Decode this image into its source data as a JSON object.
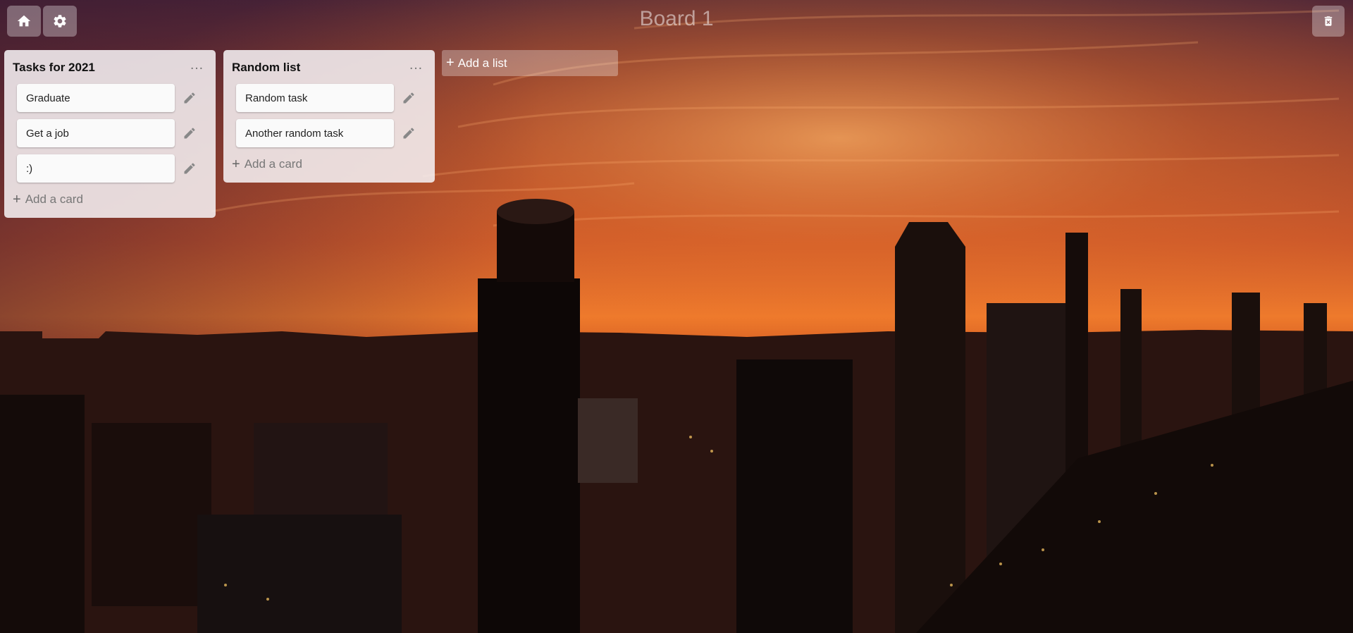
{
  "toolbar": {
    "home_icon": "home-icon",
    "settings_icon": "gear-icon",
    "delete_icon": "trash-icon"
  },
  "board": {
    "title": "Board 1"
  },
  "lists": [
    {
      "title": "Tasks for 2021",
      "menu": "…",
      "cards": [
        ":)",
        "Get a job",
        "Graduate"
      ],
      "add_card_label": "Add a card"
    },
    {
      "title": "Random list",
      "menu": "…",
      "cards": [
        "Random task",
        "Another random task"
      ],
      "add_card_label": "Add a card"
    }
  ],
  "add_list": {
    "label": "Add a list"
  },
  "colors": {
    "sky_top": "#5a2a3a",
    "sky_glow": "#f07a2a",
    "city_dark": "#1a0a08"
  }
}
